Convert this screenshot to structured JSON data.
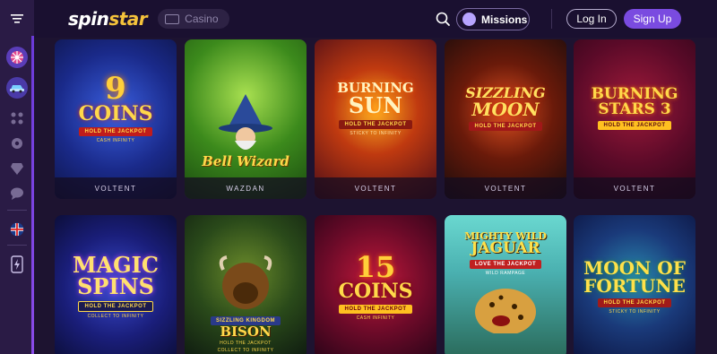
{
  "app": {
    "logo_part1": "spin",
    "logo_part2": "star",
    "casino_label": "Casino",
    "missions_label": "Missions",
    "login_label": "Log In",
    "signup_label": "Sign Up"
  },
  "colors": {
    "brand_yellow": "#f5c33b",
    "accent_purple": "#7a4be0",
    "background": "#1d1330"
  },
  "sidebar": {
    "icons": [
      "menu-icon",
      "spin-wheel-icon",
      "car-icon",
      "dots-grid-icon",
      "gear-icon",
      "diamond-icon",
      "chat-icon",
      "uk-flag-icon",
      "lightning-icon"
    ]
  },
  "games": [
    {
      "title": "9",
      "title2": "COINS",
      "band": "HOLD THE JACKPOT",
      "sub": "CASH INFINITY",
      "provider": "VOLTENT"
    },
    {
      "title": "Bell",
      "title2": "Wizard",
      "band": "",
      "sub": "",
      "provider": "WAZDAN"
    },
    {
      "title": "BURNING",
      "title2": "SUN",
      "band": "HOLD THE JACKPOT",
      "sub": "STICKY TO INFINITY",
      "provider": "VOLTENT"
    },
    {
      "title": "SIZZLING",
      "title2": "MOON",
      "band": "HOLD THE JACKPOT",
      "sub": "",
      "provider": "VOLTENT"
    },
    {
      "title": "BURNING",
      "title2": "STARS 3",
      "band": "HOLD THE JACKPOT",
      "sub": "",
      "provider": "VOLTENT"
    },
    {
      "title": "MAGIC",
      "title2": "SPINS",
      "band": "HOLD THE JACKPOT",
      "sub": "COLLECT TO INFINITY",
      "provider": ""
    },
    {
      "title": "SIZZLING KINGDOM",
      "title2": "BISON",
      "band": "HOLD THE JACKPOT",
      "sub": "COLLECT TO INFINITY",
      "provider": ""
    },
    {
      "title": "15",
      "title2": "COINS",
      "band": "HOLD THE JACKPOT",
      "sub": "CASH INFINITY",
      "provider": ""
    },
    {
      "title": "MIGHTY WILD",
      "title2": "JAGUAR",
      "band": "LOVE THE JACKPOT",
      "sub": "WILD RAMPAGE",
      "provider": ""
    },
    {
      "title": "MOON OF",
      "title2": "FORTUNE",
      "band": "HOLD THE JACKPOT",
      "sub": "STICKY TO INFINITY",
      "provider": ""
    }
  ]
}
